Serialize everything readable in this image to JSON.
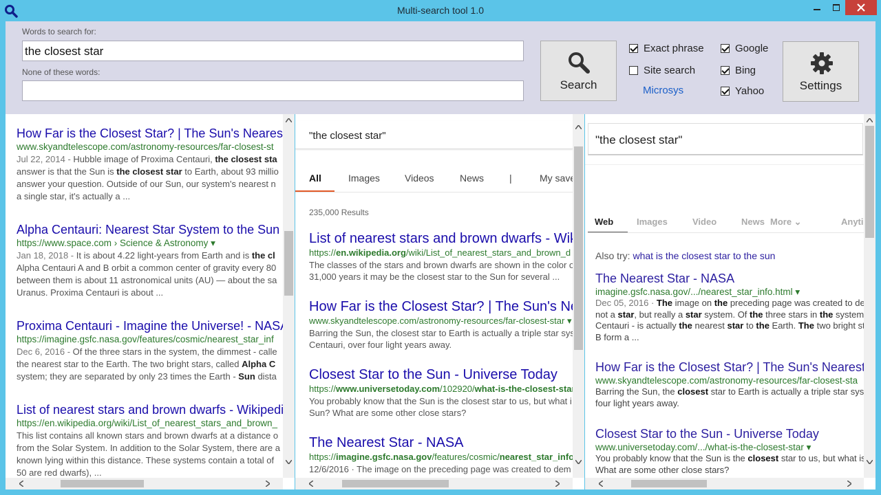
{
  "window": {
    "title": "Multi-search tool 1.0"
  },
  "toolbar": {
    "words_label": "Words to search for:",
    "words_value": "the closest star",
    "none_label": "None of these words:",
    "none_value": "",
    "search_label": "Search",
    "settings_label": "Settings",
    "exact_phrase": {
      "label": "Exact phrase",
      "checked": true
    },
    "site_search": {
      "label": "Site search",
      "checked": false
    },
    "site_link": "Microsys",
    "google": {
      "label": "Google",
      "checked": true
    },
    "bing": {
      "label": "Bing",
      "checked": true
    },
    "yahoo": {
      "label": "Yahoo",
      "checked": true
    }
  },
  "google_pane": {
    "results": [
      {
        "title": "How Far is the Closest Star? | The Sun's Nearest",
        "url": "www.skyandtelescope.com/astronomy-resources/far-closest-st",
        "date": "Jul 22, 2014",
        "lines": [
          "Jul 22, 2014 - Hubble image of Proxima Centauri, the closest sta",
          "answer is that the Sun is the closest star to Earth, about 93 millio",
          "answer your question. Outside of our Sun, our system's nearest n",
          "a single star, it's actually a ..."
        ]
      },
      {
        "title": "Alpha Centauri: Nearest Star System to the Sun",
        "url": "https://www.space.com › Science & Astronomy ▾",
        "lines": [
          "Jan 18, 2018 - It is about 4.22 light-years from Earth and is the cl",
          "Alpha Centauri A and B orbit a common center of gravity every 80",
          "between them is about 11 astronomical units (AU) — about the sa",
          "Uranus. Proxima Centauri is about ..."
        ]
      },
      {
        "title": "Proxima Centauri - Imagine the Universe! - NASA",
        "url": "https://imagine.gsfc.nasa.gov/features/cosmic/nearest_star_inf",
        "lines": [
          "Dec 6, 2016 - Of the three stars in the system, the dimmest - calle",
          "the nearest star to the Earth. The two bright stars, called Alpha C",
          "system; they are separated by only 23 times the Earth - Sun dista"
        ]
      },
      {
        "title": "List of nearest stars and brown dwarfs - Wikipedi",
        "url": "https://en.wikipedia.org/wiki/List_of_nearest_stars_and_brown_",
        "lines": [
          "This list contains all known stars and brown dwarfs at a distance o",
          "from the Solar System. In addition to the Solar System, there are a",
          "known lying within this distance. These systems contain a total of",
          "50 are red dwarfs), ..."
        ]
      }
    ]
  },
  "bing_pane": {
    "query": "\"the closest star\"",
    "tabs": [
      "All",
      "Images",
      "Videos",
      "News",
      "|",
      "My save"
    ],
    "count": "235,000 Results",
    "results": [
      {
        "title": "List of nearest stars and brown dwarfs - Wik",
        "url": "https://en.wikipedia.org/wiki/List_of_nearest_stars_and_brown_d",
        "lines": [
          "The classes of the stars and brown dwarfs are shown in the color o",
          "31,000 years it may be the closest star to the Sun for several ..."
        ]
      },
      {
        "title": "How Far is the Closest Star? | The Sun's Nea",
        "url": "www.skyandtelescope.com/astronomy-resources/far-closest-star ▾",
        "lines": [
          "Barring the Sun, the closest star to Earth is actually a triple star sys",
          "Centauri, over four light years away."
        ]
      },
      {
        "title": "Closest Star to the Sun - Universe Today",
        "url": "https://www.universetoday.com/102920/what-is-the-closest-star",
        "lines": [
          "You probably know that the Sun is the closest star to us, but what i",
          "Sun? What are some other close stars?"
        ]
      },
      {
        "title": "The Nearest Star - NASA",
        "url": "https://imagine.gsfc.nasa.gov/features/cosmic/nearest_star_info",
        "lines": [
          "12/6/2016 · The image on the preceding page was created to dem"
        ]
      }
    ]
  },
  "yahoo_pane": {
    "query": "\"the closest star\"",
    "tabs": [
      "Web",
      "Images",
      "Video",
      "News",
      "More ⌄",
      "Anyti"
    ],
    "also_try_label": "Also try:",
    "also_try_link": "what is the closest star to the sun",
    "results": [
      {
        "title": "The Nearest Star - NASA",
        "url": "imagine.gsfc.nasa.gov/.../nearest_star_info.html ▾",
        "lines": [
          "Dec 05, 2016 · The image on the preceding page was created to de",
          "not a star, but really a star system. Of the three stars in the system",
          "Centauri - is actually the nearest star to the Earth. The two bright st",
          "B form a ..."
        ]
      },
      {
        "title": "How Far is the Closest Star? | The Sun's Nearest",
        "url": "www.skyandtelescope.com/astronomy-resources/far-closest-sta",
        "lines": [
          "Barring the Sun, the closest star to Earth is actually a triple star sys",
          "four light years away."
        ]
      },
      {
        "title": "Closest Star to the Sun - Universe Today",
        "url": "www.universetoday.com/.../what-is-the-closest-star ▾",
        "lines": [
          "You probably know that the Sun is the closest star to us, but what is",
          "What are some other close stars?"
        ]
      }
    ]
  },
  "colors": {
    "accent": "#5bc4e8",
    "toolbar_bg": "#d9d9e8",
    "link": "#1a0dab",
    "url_green": "#2d7a2d",
    "bing_tab_active": "#e25a28"
  },
  "icons": {
    "app": "search-icon",
    "search_button": "search-icon",
    "settings_button": "gear-icon"
  }
}
